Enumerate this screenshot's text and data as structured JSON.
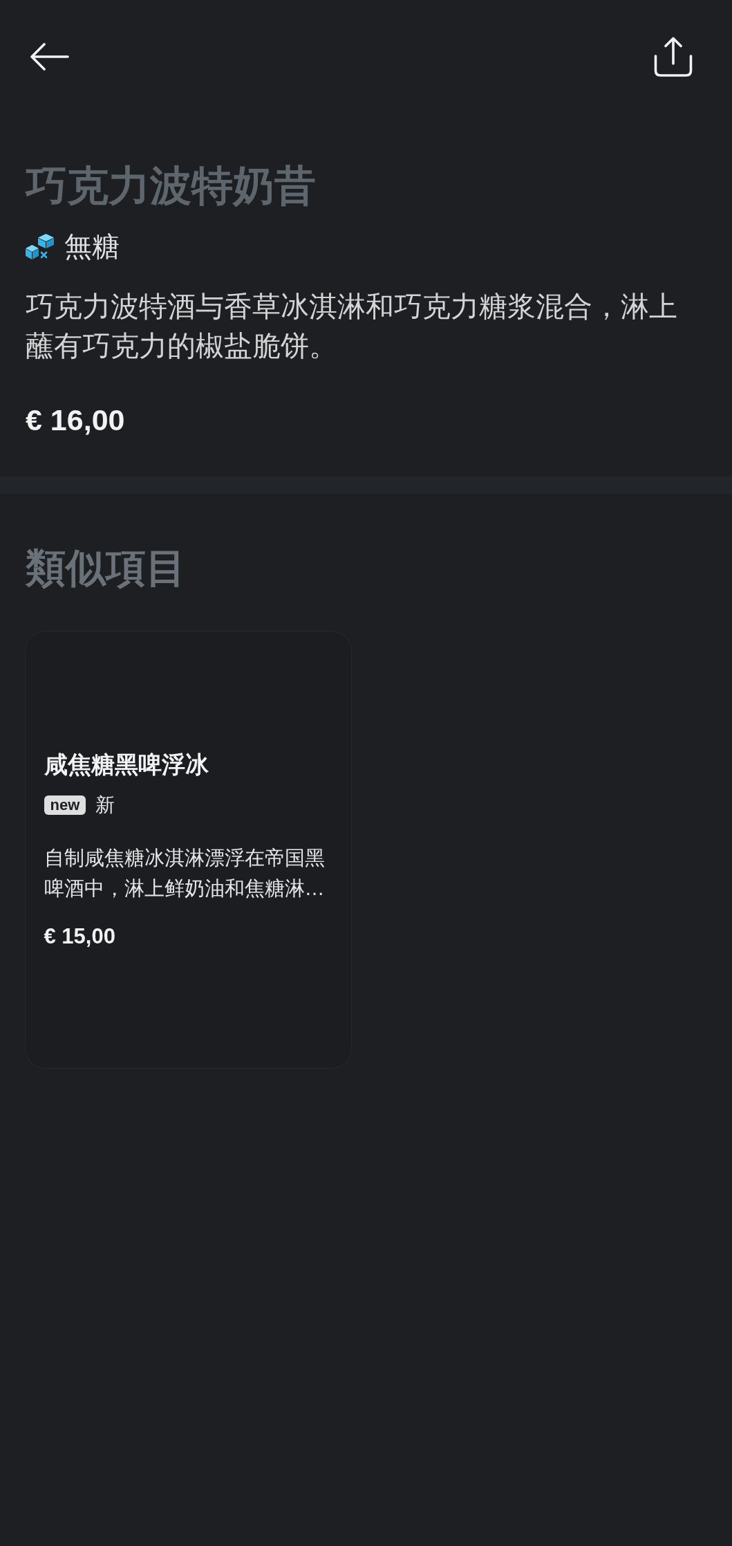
{
  "product": {
    "title": "巧克力波特奶昔",
    "tags": [
      {
        "kind": "dietary",
        "label": "無糖"
      }
    ],
    "description": "巧克力波特酒与香草冰淇淋和巧克力糖浆混合，淋上蘸有巧克力的椒盐脆饼。",
    "price": "€ 16,00"
  },
  "similar": {
    "heading": "類似項目",
    "items": [
      {
        "title": "咸焦糖黑啤浮冰",
        "tags": [
          {
            "kind": "badge",
            "badge": "new",
            "label": "新"
          }
        ],
        "description": "自制咸焦糖冰淇淋漂浮在帝国黑啤酒中，淋上鲜奶油和焦糖淋…",
        "price": "€ 15,00"
      }
    ]
  }
}
